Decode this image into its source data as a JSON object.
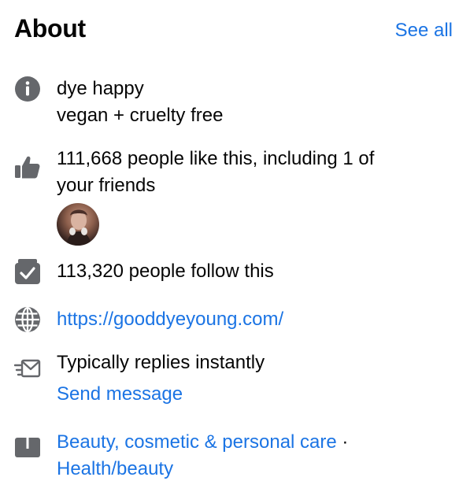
{
  "header": {
    "title": "About",
    "see_all": "See all"
  },
  "about": {
    "bio_line1": "dye happy",
    "bio_line2": "vegan + cruelty free",
    "likes_line1": "111,668 people like this, including 1 of",
    "likes_line2": "your friends",
    "follows": "113,320 people follow this",
    "website": "https://gooddyeyoung.com/",
    "replies": "Typically replies instantly",
    "send_message": "Send message",
    "category_1": "Beauty, cosmetic & personal care",
    "category_sep": " ·",
    "category_2": "Health/beauty"
  },
  "icons": {
    "info": "info-icon",
    "like": "thumbs-up-icon",
    "follow": "follow-check-icon",
    "website": "globe-icon",
    "message": "message-envelope-icon",
    "category": "category-folder-icon"
  },
  "colors": {
    "link": "#1b74e4",
    "icon": "#65676b",
    "text": "#050505"
  }
}
